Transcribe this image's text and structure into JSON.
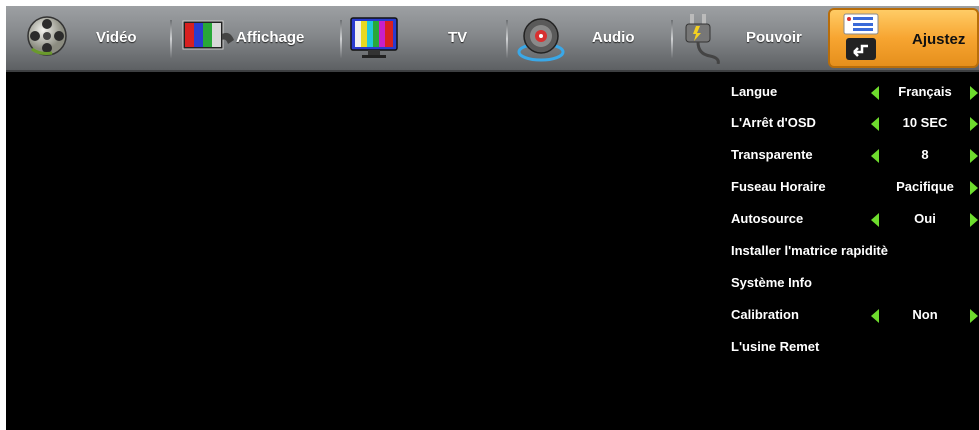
{
  "tabs": [
    {
      "id": "video",
      "label": "Vidéo",
      "icon": "film-reel-icon"
    },
    {
      "id": "display",
      "label": "Affichage",
      "icon": "color-bars-icon"
    },
    {
      "id": "tv",
      "label": "TV",
      "icon": "monitor-icon"
    },
    {
      "id": "audio",
      "label": "Audio",
      "icon": "speaker-icon"
    },
    {
      "id": "power",
      "label": "Pouvoir",
      "icon": "power-plug-icon"
    },
    {
      "id": "adjust",
      "label": "Ajustez",
      "icon": "settings-list-icon",
      "active": true
    }
  ],
  "settings": [
    {
      "label": "Langue",
      "value": "Français",
      "arrows": "both"
    },
    {
      "label": "L'Arrêt d'OSD",
      "value": "10 SEC",
      "arrows": "both"
    },
    {
      "label": "Transparente",
      "value": "8",
      "arrows": "both"
    },
    {
      "label": "Fuseau Horaire",
      "value": "Pacifique",
      "arrows": "right"
    },
    {
      "label": "Autosource",
      "value": "Oui",
      "arrows": "both"
    },
    {
      "label": "Installer l'matrice rapiditè",
      "value": "",
      "arrows": "none"
    },
    {
      "label": "Système Info",
      "value": "",
      "arrows": "none"
    },
    {
      "label": "Calibration",
      "value": "Non",
      "arrows": "both"
    },
    {
      "label": "L'usine Remet",
      "value": "",
      "arrows": "none"
    }
  ],
  "colors": {
    "accent": "#f7a531",
    "arrow": "#6edb2d",
    "background": "#000000",
    "bar": "#85888b"
  }
}
